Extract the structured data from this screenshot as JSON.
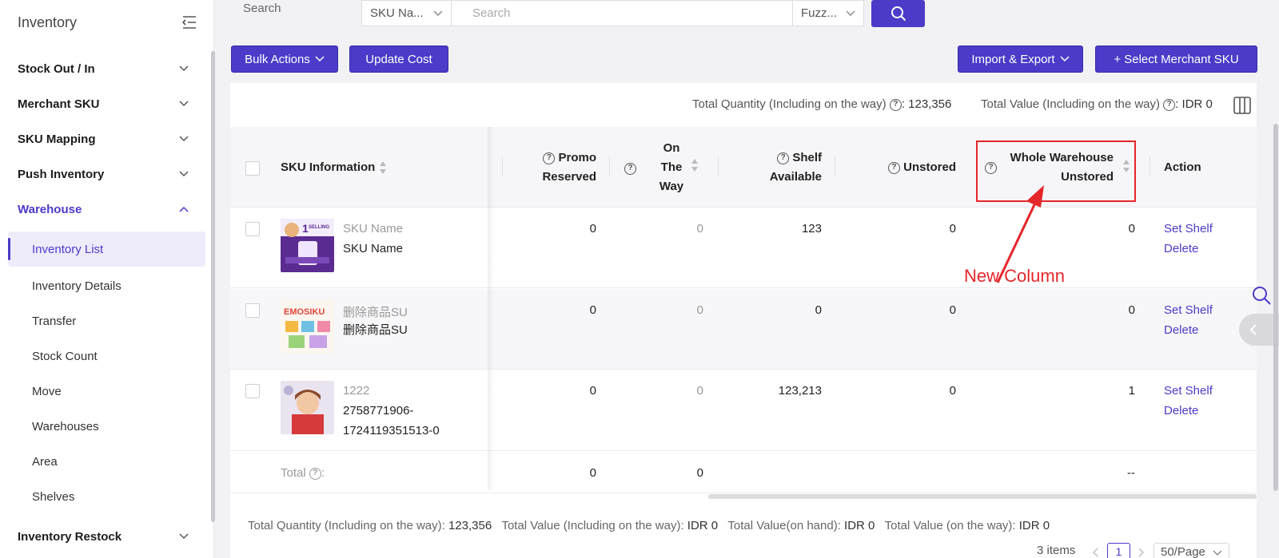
{
  "sidebar": {
    "title": "Inventory",
    "menu": [
      {
        "label": "Stock Out / In"
      },
      {
        "label": "Merchant SKU"
      },
      {
        "label": "SKU Mapping"
      },
      {
        "label": "Push Inventory"
      },
      {
        "label": "Warehouse"
      }
    ],
    "warehouse_sub": [
      {
        "label": "Inventory List"
      },
      {
        "label": "Inventory Details"
      },
      {
        "label": "Transfer"
      },
      {
        "label": "Stock Count"
      },
      {
        "label": "Move"
      },
      {
        "label": "Warehouses"
      },
      {
        "label": "Area"
      },
      {
        "label": "Shelves"
      }
    ],
    "restock": "Inventory Restock"
  },
  "filter": {
    "label": "Search",
    "field_select": "SKU Na...",
    "placeholder": "Search",
    "mode_select": "Fuzz..."
  },
  "toolbar": {
    "bulk_actions": "Bulk Actions",
    "update_cost": "Update Cost",
    "import_export": "Import & Export",
    "select_merchant_sku": "+ Select Merchant SKU"
  },
  "summary_top": {
    "qty_label": "Total Quantity (Including on the way)",
    "qty_value": ": 123,356",
    "value_label": "Total Value (Including on the way)",
    "value_value": ": IDR 0"
  },
  "table": {
    "headers": {
      "sku_info": "SKU Information",
      "promo_1": "Promo",
      "promo_2": "Reserved",
      "otw_1": "On",
      "otw_2": "The",
      "otw_3": "Way",
      "shelf_1": "Shelf",
      "shelf_2": "Available",
      "unstored": "Unstored",
      "whole_1": "Whole Warehouse",
      "whole_2": "Unstored",
      "action": "Action"
    },
    "rows": [
      {
        "sku_name": "SKU Name",
        "sku_code": "SKU Name",
        "promo": "0",
        "otw": "0",
        "shelf": "123",
        "unstored": "0",
        "whole": "0"
      },
      {
        "sku_name": "删除商品SU",
        "sku_code": "删除商品SU",
        "promo": "0",
        "otw": "0",
        "shelf": "0",
        "unstored": "0",
        "whole": "0"
      },
      {
        "sku_name": "1222",
        "sku_code_1": "2758771906-",
        "sku_code_2": "1724119351513-0",
        "promo": "0",
        "otw": "0",
        "shelf": "123,213",
        "unstored": "0",
        "whole": "1"
      }
    ],
    "action_set_shelf": "Set Shelf",
    "action_delete": "Delete",
    "total_label": "Total",
    "total_promo": "0",
    "total_otw": "0",
    "total_whole": "--"
  },
  "thumbs": {
    "t1_big": "1",
    "t1_small": "SELLING",
    "t2": "EMOSIKU"
  },
  "summary_bottom": {
    "q_label": "Total Quantity (Including on the way):",
    "q_value": "123,356",
    "v_label": "Total Value (Including on the way):",
    "v_value": "IDR 0",
    "h_label": "Total Value(on hand):",
    "h_value": "IDR 0",
    "w_label": "Total Value (on the way):",
    "w_value": "IDR 0"
  },
  "pagination": {
    "items": "3 items",
    "current": "1",
    "page_size": "50/Page"
  },
  "annotation": {
    "text": "New Column"
  },
  "colors": {
    "primary": "#4b3bc8",
    "annotation": "#e5262a"
  }
}
